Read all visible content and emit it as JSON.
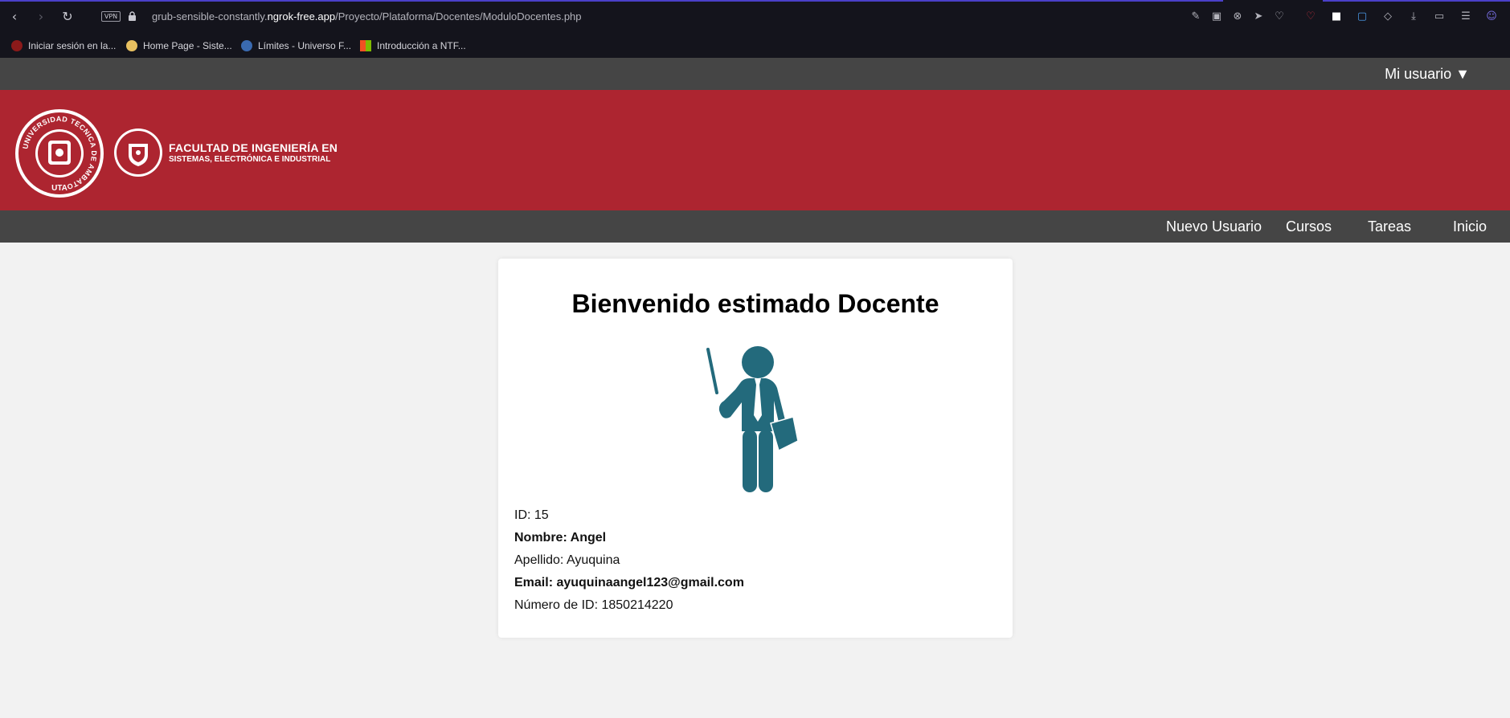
{
  "browser": {
    "vpn_label": "VPN",
    "url_prefix": "grub-sensible-constantly.",
    "url_host": "ngrok-free.app",
    "url_path": "/Proyecto/Plataforma/Docentes/ModuloDocentes.php"
  },
  "bookmarks": [
    {
      "label": "Iniciar sesión en la...",
      "color": "#8b1a1a"
    },
    {
      "label": "Home Page - Siste...",
      "color": "#e8c060"
    },
    {
      "label": "Límites - Universo F...",
      "color": "#3a6ab0"
    },
    {
      "label": "Introducción a NTF...",
      "color": "#f25022"
    }
  ],
  "header": {
    "user_menu": "Mi usuario ▼",
    "seal_ring_text": "UNIVERSIDAD TECNICA DE AMBATO",
    "seal_bottom_text": "UTA",
    "faculty_line1": "FACULTAD DE INGENIERÍA EN",
    "faculty_line2": "SISTEMAS, ELECTRÓNICA E INDUSTRIAL",
    "brand_color": "#ad2530"
  },
  "nav": {
    "items": [
      "Nuevo Usuario",
      "Cursos",
      "Tareas",
      "Inicio"
    ]
  },
  "profile": {
    "title": "Bienvenido estimado Docente",
    "id": "ID: 15",
    "nombre": "Nombre: Angel",
    "apellido": "Apellido: Ayuquina",
    "email": "Email: ayuquinaangel123@gmail.com",
    "numero_id": "Número de ID: 1850214220",
    "figure_icon": "teacher-icon",
    "figure_color": "#236a7c"
  }
}
